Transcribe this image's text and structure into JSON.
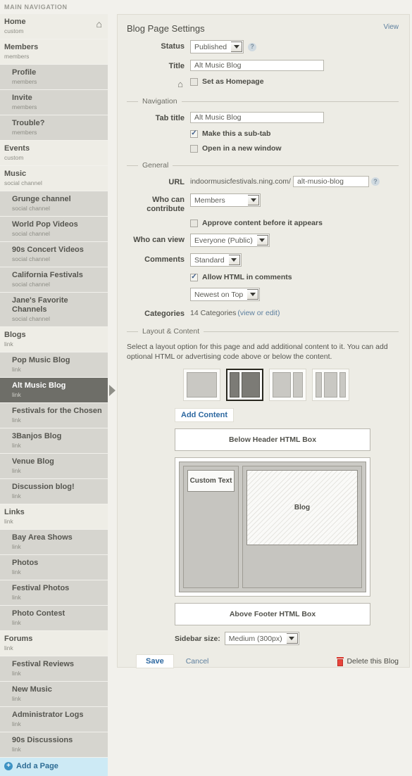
{
  "sidebar": {
    "heading": "MAIN NAVIGATION",
    "items": [
      {
        "title": "Home",
        "sub": "custom",
        "level": "parent",
        "icon": "home-icon",
        "selected": false
      },
      {
        "title": "Members",
        "sub": "members",
        "level": "parent",
        "selected": false
      },
      {
        "title": "Profile",
        "sub": "members",
        "level": "child",
        "selected": false
      },
      {
        "title": "Invite",
        "sub": "members",
        "level": "child",
        "selected": false
      },
      {
        "title": "Trouble?",
        "sub": "members",
        "level": "child",
        "selected": false
      },
      {
        "title": "Events",
        "sub": "custom",
        "level": "parent",
        "selected": false
      },
      {
        "title": "Music",
        "sub": "social channel",
        "level": "parent",
        "selected": false
      },
      {
        "title": "Grunge channel",
        "sub": "social channel",
        "level": "child",
        "selected": false
      },
      {
        "title": "World Pop Videos",
        "sub": "social channel",
        "level": "child",
        "selected": false
      },
      {
        "title": "90s Concert Videos",
        "sub": "social channel",
        "level": "child",
        "selected": false
      },
      {
        "title": "California Festivals",
        "sub": "social channel",
        "level": "child",
        "selected": false
      },
      {
        "title": "Jane's Favorite Channels",
        "sub": "social channel",
        "level": "child",
        "selected": false
      },
      {
        "title": "Blogs",
        "sub": "link",
        "level": "parent",
        "selected": false
      },
      {
        "title": "Pop Music Blog",
        "sub": "link",
        "level": "child",
        "selected": false
      },
      {
        "title": "Alt Music Blog",
        "sub": "link",
        "level": "child",
        "selected": true
      },
      {
        "title": "Festivals for the Chosen",
        "sub": "link",
        "level": "child",
        "selected": false
      },
      {
        "title": "3Banjos Blog",
        "sub": "link",
        "level": "child",
        "selected": false
      },
      {
        "title": "Venue Blog",
        "sub": "link",
        "level": "child",
        "selected": false
      },
      {
        "title": "Discussion blog!",
        "sub": "link",
        "level": "child",
        "selected": false
      },
      {
        "title": "Links",
        "sub": "link",
        "level": "parent",
        "selected": false
      },
      {
        "title": "Bay Area Shows",
        "sub": "link",
        "level": "child",
        "selected": false
      },
      {
        "title": "Photos",
        "sub": "link",
        "level": "child",
        "selected": false
      },
      {
        "title": "Festival Photos",
        "sub": "link",
        "level": "child",
        "selected": false
      },
      {
        "title": "Photo Contest",
        "sub": "link",
        "level": "child",
        "selected": false
      },
      {
        "title": "Forums",
        "sub": "link",
        "level": "parent",
        "selected": false
      },
      {
        "title": "Festival Reviews",
        "sub": "link",
        "level": "child",
        "selected": false
      },
      {
        "title": "New Music",
        "sub": "link",
        "level": "child",
        "selected": false
      },
      {
        "title": "Administrator Logs",
        "sub": "link",
        "level": "child",
        "selected": false
      },
      {
        "title": "90s Discussions",
        "sub": "link",
        "level": "child",
        "selected": false
      }
    ],
    "add_page_label": "Add a Page",
    "add_page_icon": "plus-circle-icon"
  },
  "panel": {
    "title": "Blog Page Settings",
    "view_link": "View",
    "status": {
      "label": "Status",
      "value": "Published",
      "help_icon": "help-circle-icon"
    },
    "title_field": {
      "label": "Title",
      "value": "Alt Music Blog"
    },
    "homepage": {
      "home_icon": "home-icon",
      "label": "Set as Homepage",
      "checked": false
    },
    "navigation_section": {
      "name": "Navigation",
      "tab_title": {
        "label": "Tab title",
        "value": "Alt Music Blog"
      },
      "sub_tab": {
        "label": "Make this a sub-tab",
        "checked": true
      },
      "new_window": {
        "label": "Open in a new window",
        "checked": false
      }
    },
    "general_section": {
      "name": "General",
      "url": {
        "label": "URL",
        "prefix": "indoormusicfestivals.ning.com/",
        "value": "alt-musio-blog",
        "help_icon": "help-circle-icon"
      },
      "who_can_contribute": {
        "label": "Who can contribute",
        "value": "Members"
      },
      "approve": {
        "label": "Approve content before it appears",
        "checked": false
      },
      "who_can_view": {
        "label": "Who can view",
        "value": "Everyone (Public)"
      },
      "comments": {
        "label": "Comments",
        "value": "Standard"
      },
      "allow_html": {
        "label": "Allow HTML in comments",
        "checked": true
      },
      "comment_order": {
        "value": "Newest on Top"
      },
      "categories": {
        "label": "Categories",
        "count_text": "14 Categories ",
        "link_text": "(view or edit)"
      }
    },
    "layout_section": {
      "name": "Layout & Content",
      "description": "Select a layout option for this page and add additional content to it. You can add optional HTML or advertising code above or below the content.",
      "thumbnails": [
        {
          "name": "one-column",
          "panes": [
            100
          ],
          "selected": false
        },
        {
          "name": "two-column",
          "panes": [
            33,
            67
          ],
          "selected": true
        },
        {
          "name": "content-right-sidebar",
          "panes": [
            67,
            33
          ],
          "selected": false
        },
        {
          "name": "three-column",
          "panes": [
            22,
            50,
            22
          ],
          "selected": false
        }
      ],
      "add_content_label": "Add Content",
      "below_header_box": "Below Header HTML Box",
      "above_footer_box": "Above Footer HTML Box",
      "preview": {
        "custom_text": "Custom Text",
        "blog": "Blog"
      },
      "sidebar_size": {
        "label": "Sidebar size:",
        "value": "Medium (300px)"
      }
    },
    "footer": {
      "save_label": "Save",
      "cancel_label": "Cancel",
      "delete_label": "Delete this Blog",
      "delete_icon": "trash-icon"
    }
  },
  "colors": {
    "page_bg": "#f2f1ec",
    "panel_bg": "#edece5",
    "selected_nav": "#6e6e68",
    "link_blue": "#5d7f9e",
    "action_blue": "#2d68a0",
    "add_page_bg": "#cdeaf5",
    "delete_red": "#e8453c"
  }
}
